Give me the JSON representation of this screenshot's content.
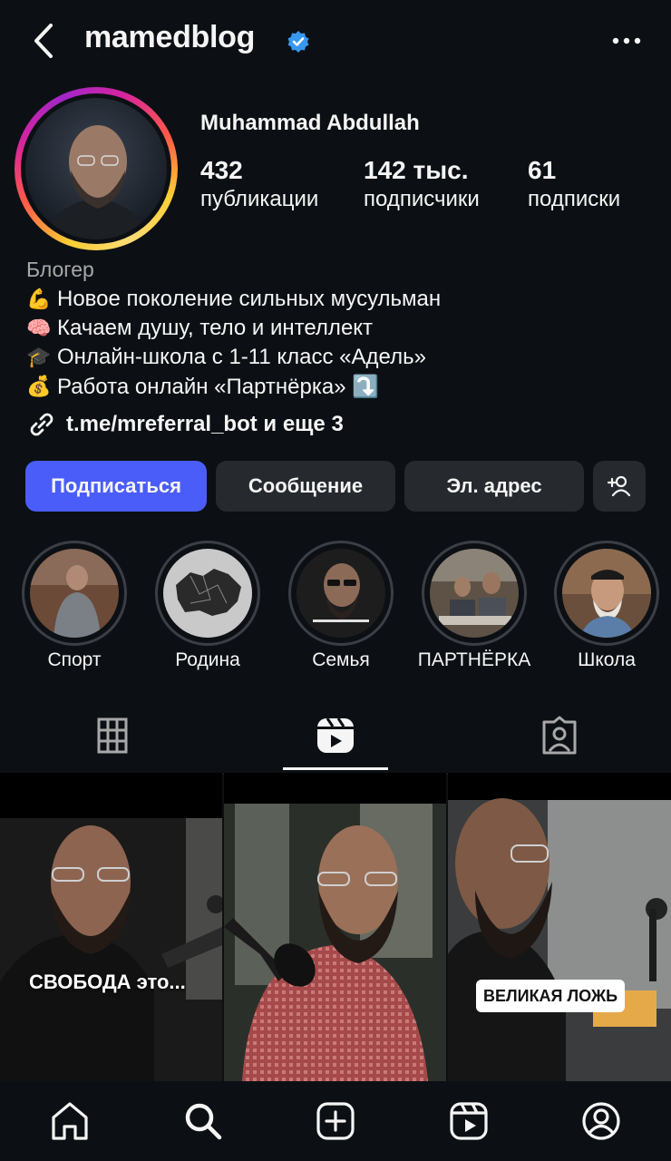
{
  "header": {
    "username": "mamedblog",
    "verified_icon": "verified-badge-icon",
    "back_icon": "chevron-left-icon",
    "more_icon": "more-horizontal-icon"
  },
  "profile": {
    "full_name": "Muhammad Abdullah",
    "stats": [
      {
        "value": "432",
        "label": "публикации"
      },
      {
        "value": "142 тыс.",
        "label": "подписчики"
      },
      {
        "value": "61",
        "label": "подписки"
      }
    ],
    "category": "Блогер",
    "bio": [
      {
        "emoji": "💪",
        "text": "Новое поколение сильных мусульман"
      },
      {
        "emoji": "🧠",
        "text": "Качаем душу, тело и интеллект"
      },
      {
        "emoji": "🎓",
        "text": "Онлайн-школа с 1-11 класс «Адель»"
      },
      {
        "emoji": "💰",
        "text": "Работа онлайн «Партнёрка» ⤵️"
      }
    ],
    "link_text": "t.me/mreferral_bot и еще 3"
  },
  "actions": {
    "follow": "Подписаться",
    "message": "Сообщение",
    "email": "Эл. адрес",
    "add_user_icon": "add-person-icon"
  },
  "highlights": [
    {
      "label": "Спорт"
    },
    {
      "label": "Родина"
    },
    {
      "label": "Семья"
    },
    {
      "label": "ПАРТНЁРКА"
    },
    {
      "label": "Школа"
    }
  ],
  "tabs": [
    {
      "icon": "grid-icon"
    },
    {
      "icon": "reels-icon",
      "active": true
    },
    {
      "icon": "tagged-icon"
    }
  ],
  "posts": [
    {
      "caption": "СВОБОДА это..."
    },
    {
      "caption": ""
    },
    {
      "caption": "ВЕЛИКАЯ ЛОЖЬ"
    }
  ],
  "bottom_nav": [
    "home-icon",
    "search-icon",
    "create-icon",
    "reels-icon",
    "profile-icon"
  ],
  "colors": {
    "background": "#0c1014",
    "follow_button": "#4a5df9",
    "secondary_button": "#26292e",
    "verified": "#3897f0",
    "muted_text": "#a8a8a8"
  }
}
